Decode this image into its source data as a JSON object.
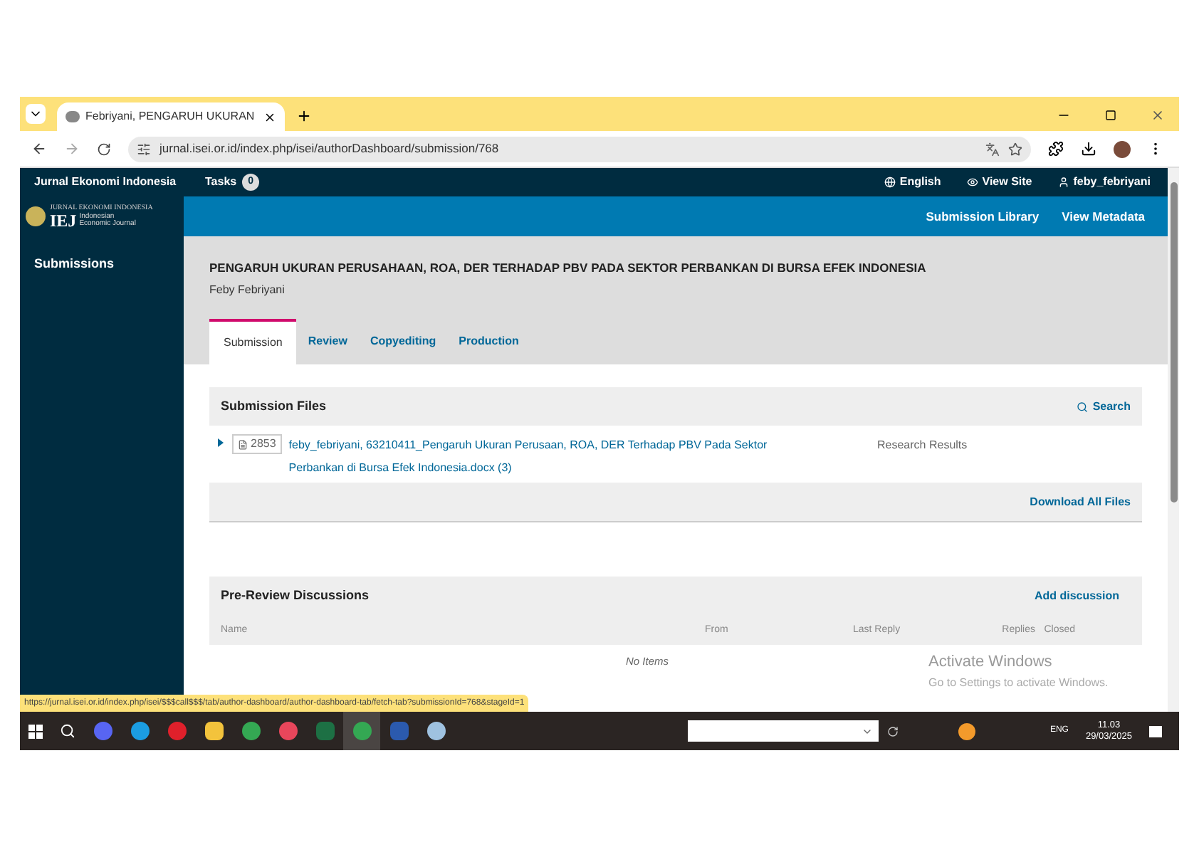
{
  "browser": {
    "tab_title": "Febriyani, PENGARUH UKURAN",
    "address": "jurnal.isei.or.id/index.php/isei/authorDashboard/submission/768"
  },
  "site": {
    "name": "Jurnal Ekonomi Indonesia",
    "tasks_label": "Tasks",
    "tasks_count": "0",
    "language": "English",
    "view_site": "View Site",
    "user": "feby_febriyani"
  },
  "logo": {
    "line1": "JURNAL EKONOMI INDONESIA",
    "mark": "IEJ",
    "line2": "Indonesian Economic Journal"
  },
  "sidebar": {
    "items": [
      {
        "label": "Submissions"
      }
    ]
  },
  "header_links": [
    "Submission Library",
    "View Metadata"
  ],
  "submission": {
    "title": "PENGARUH UKURAN PERUSAHAAN, ROA, DER TERHADAP PBV PADA SEKTOR PERBANKAN DI BURSA EFEK INDONESIA",
    "author": "Feby Febriyani"
  },
  "tabs": [
    {
      "label": "Submission",
      "selected": true
    },
    {
      "label": "Review",
      "selected": false
    },
    {
      "label": "Copyediting",
      "selected": false
    },
    {
      "label": "Production",
      "selected": false
    }
  ],
  "files_panel": {
    "title": "Submission Files",
    "search": "Search",
    "files": [
      {
        "id": "2853",
        "name": "feby_febriyani, 63210411_Pengaruh Ukuran Perusaan, ROA, DER Terhadap PBV Pada Sektor Perbankan di Bursa Efek Indonesia.docx (3)",
        "type": "Research Results"
      }
    ],
    "download": "Download All Files"
  },
  "discussions": {
    "title": "Pre-Review Discussions",
    "add": "Add discussion",
    "columns": [
      "Name",
      "From",
      "Last Reply",
      "Replies",
      "Closed"
    ],
    "empty": "No Items"
  },
  "activation": {
    "title": "Activate Windows",
    "hint": "Go to Settings to activate Windows."
  },
  "status_url": "https://jurnal.isei.or.id/index.php/isei/$$$call$$$/tab/author-dashboard/author-dashboard-tab/fetch-tab?submissionId=768&stageId=1",
  "taskbar": {
    "apps": [
      {
        "kind": "chat",
        "active": false
      },
      {
        "kind": "edge",
        "active": false
      },
      {
        "kind": "opera",
        "active": false
      },
      {
        "kind": "folder",
        "active": false
      },
      {
        "kind": "chrome",
        "active": false
      },
      {
        "kind": "red",
        "active": false
      },
      {
        "kind": "excel",
        "active": false
      },
      {
        "kind": "chrome",
        "active": true
      },
      {
        "kind": "word",
        "active": false
      },
      {
        "kind": "paint",
        "active": false
      }
    ],
    "language": "ENG",
    "time": "11.03",
    "date": "29/03/2025"
  }
}
